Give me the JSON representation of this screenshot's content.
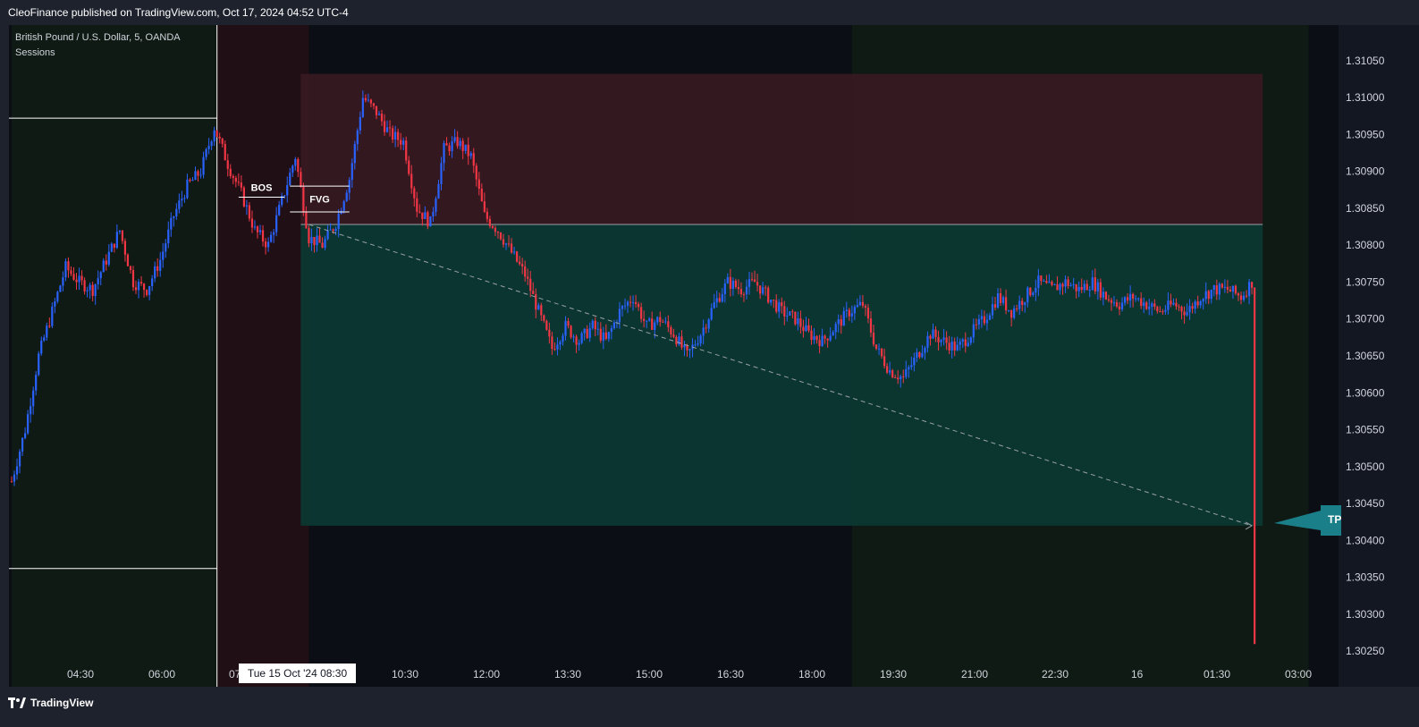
{
  "header": {
    "published": "CleoFinance published on TradingView.com, Oct 17, 2024 04:52 UTC-4"
  },
  "legend": {
    "symbol": "British Pound / U.S. Dollar, 5, OANDA",
    "indicator": "Sessions"
  },
  "branding": {
    "logo_text": "TradingView"
  },
  "annotations": {
    "bos": "BOS",
    "fvg": "FVG",
    "tp_label": "TP"
  },
  "crosshair": {
    "time_label": "Tue 15 Oct '24   08:30"
  },
  "colors": {
    "up": "#2962ff",
    "down": "#f23645",
    "profit_zone": "#0b3a33",
    "stop_zone": "#3b1a22"
  },
  "chart_data": {
    "type": "candlestick",
    "symbol": "British Pound / U.S. Dollar",
    "timeframe": "5",
    "x_ticks": [
      "04:30",
      "06:00",
      "07",
      "10:30",
      "12:00",
      "13:30",
      "15:00",
      "16:30",
      "18:00",
      "19:30",
      "21:00",
      "22:30",
      "16",
      "01:30",
      "03:00"
    ],
    "y_ticks": [
      "1.31050",
      "1.31000",
      "1.30950",
      "1.30900",
      "1.30850",
      "1.30800",
      "1.30750",
      "1.30700",
      "1.30650",
      "1.30600",
      "1.30550",
      "1.30500",
      "1.30450",
      "1.30400",
      "1.30350",
      "1.30300",
      "1.30250"
    ],
    "ylim": [
      1.3022,
      1.3108
    ],
    "price_path": [
      [
        0,
        1.3048
      ],
      [
        5,
        1.3055
      ],
      [
        10,
        1.3065
      ],
      [
        15,
        1.3071
      ],
      [
        20,
        1.3077
      ],
      [
        25,
        1.3075
      ],
      [
        30,
        1.3074
      ],
      [
        35,
        1.3078
      ],
      [
        40,
        1.3082
      ],
      [
        45,
        1.3075
      ],
      [
        50,
        1.3074
      ],
      [
        55,
        1.3078
      ],
      [
        60,
        1.3084
      ],
      [
        65,
        1.3088
      ],
      [
        70,
        1.309
      ],
      [
        75,
        1.3096
      ],
      [
        80,
        1.3091
      ],
      [
        85,
        1.3087
      ],
      [
        90,
        1.3082
      ],
      [
        95,
        1.308
      ],
      [
        100,
        1.3086
      ],
      [
        105,
        1.3092
      ],
      [
        110,
        1.3081
      ],
      [
        115,
        1.308
      ],
      [
        120,
        1.3083
      ],
      [
        125,
        1.3089
      ],
      [
        130,
        1.31
      ],
      [
        135,
        1.3098
      ],
      [
        140,
        1.3095
      ],
      [
        145,
        1.3094
      ],
      [
        150,
        1.3085
      ],
      [
        155,
        1.3083
      ],
      [
        160,
        1.3093
      ],
      [
        165,
        1.3094
      ],
      [
        170,
        1.3092
      ],
      [
        175,
        1.3084
      ],
      [
        180,
        1.3082
      ],
      [
        185,
        1.3079
      ],
      [
        190,
        1.3076
      ],
      [
        195,
        1.3071
      ],
      [
        200,
        1.3066
      ],
      [
        205,
        1.3069
      ],
      [
        210,
        1.3067
      ],
      [
        215,
        1.3069
      ],
      [
        220,
        1.3067
      ],
      [
        225,
        1.3071
      ],
      [
        230,
        1.3073
      ],
      [
        235,
        1.3069
      ],
      [
        240,
        1.307
      ],
      [
        245,
        1.3068
      ],
      [
        250,
        1.3065
      ],
      [
        255,
        1.3068
      ],
      [
        260,
        1.3072
      ],
      [
        265,
        1.3075
      ],
      [
        270,
        1.3074
      ],
      [
        275,
        1.3075
      ],
      [
        280,
        1.3073
      ],
      [
        285,
        1.3071
      ],
      [
        290,
        1.307
      ],
      [
        295,
        1.3068
      ],
      [
        300,
        1.3067
      ],
      [
        305,
        1.3069
      ],
      [
        310,
        1.3071
      ],
      [
        315,
        1.3072
      ],
      [
        320,
        1.3066
      ],
      [
        325,
        1.3063
      ],
      [
        330,
        1.3062
      ],
      [
        335,
        1.3065
      ],
      [
        340,
        1.3068
      ],
      [
        345,
        1.3067
      ],
      [
        350,
        1.3066
      ],
      [
        355,
        1.3068
      ],
      [
        360,
        1.307
      ],
      [
        365,
        1.3073
      ],
      [
        370,
        1.3071
      ],
      [
        375,
        1.3073
      ],
      [
        380,
        1.3075
      ],
      [
        385,
        1.3074
      ],
      [
        390,
        1.3075
      ],
      [
        395,
        1.3074
      ],
      [
        400,
        1.3075
      ],
      [
        405,
        1.3073
      ],
      [
        410,
        1.3072
      ],
      [
        415,
        1.3073
      ],
      [
        420,
        1.3072
      ],
      [
        425,
        1.3071
      ],
      [
        430,
        1.3072
      ],
      [
        435,
        1.3071
      ],
      [
        440,
        1.3073
      ],
      [
        445,
        1.3074
      ],
      [
        450,
        1.3074
      ],
      [
        455,
        1.3073
      ],
      [
        459,
        1.3075
      ],
      [
        460,
        1.3026
      ]
    ],
    "sessions": [
      {
        "start": 0,
        "end": 76,
        "color": "#0f1a14"
      },
      {
        "start": 76,
        "end": 110,
        "color": "#201015"
      },
      {
        "start": 311,
        "end": 480,
        "color": "#0f1a14"
      }
    ],
    "session_box": {
      "y_high": 1.30972,
      "y_low": 1.30362,
      "x_end": 76
    },
    "position": {
      "x_start": 107,
      "x_end": 463,
      "entry": 1.30828,
      "stop": 1.31032,
      "target": 1.3042
    },
    "trend_line": {
      "from": [
        110,
        1.30828
      ],
      "to": [
        459,
        1.3042
      ]
    },
    "bos_level": {
      "y": 1.30865,
      "x_start": 84,
      "x_end": 101
    },
    "fvg_level": {
      "y_top": 1.3088,
      "y_bottom": 1.30845,
      "x_start": 103,
      "x_end": 125
    }
  }
}
